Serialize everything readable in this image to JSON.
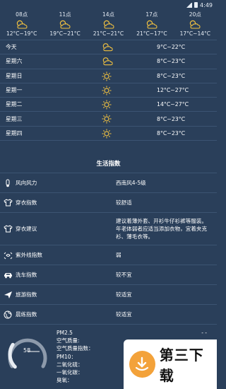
{
  "status": {
    "time": "4:49"
  },
  "hourly": [
    {
      "time": "08点",
      "icon": "partly-cloudy-icon",
      "range": "12°C~19°C"
    },
    {
      "time": "11点",
      "icon": "partly-cloudy-icon",
      "range": "19°C~21°C"
    },
    {
      "time": "14点",
      "icon": "partly-cloudy-icon",
      "range": "21°C~21°C"
    },
    {
      "time": "17点",
      "icon": "partly-cloudy-icon",
      "range": "21°C~17°C"
    },
    {
      "time": "20点",
      "icon": "partly-cloudy-icon",
      "range": "17°C~14°C"
    }
  ],
  "daily": [
    {
      "day": "今天",
      "icon": "partly-cloudy-icon",
      "temp": "9°C~22°C"
    },
    {
      "day": "星期六",
      "icon": "partly-cloudy-icon",
      "temp": "8°C~23°C"
    },
    {
      "day": "星期日",
      "icon": "sun-icon",
      "temp": "8°C~23°C"
    },
    {
      "day": "星期一",
      "icon": "sun-icon",
      "temp": "12°C~27°C"
    },
    {
      "day": "星期二",
      "icon": "sun-icon",
      "temp": "14°C~27°C"
    },
    {
      "day": "星期三",
      "icon": "sun-icon",
      "temp": "8°C~23°C"
    },
    {
      "day": "星期四",
      "icon": "sun-icon",
      "temp": "8°C~23°C"
    }
  ],
  "life": {
    "title": "生活指数",
    "items": [
      {
        "icon": "wind-icon",
        "label": "风向风力",
        "value": "西南风4-5级"
      },
      {
        "icon": "shirt-icon",
        "label": "穿衣指数",
        "value": "较舒适"
      },
      {
        "icon": "shirt-icon",
        "label": "穿衣建议",
        "value": "建议着薄外套、开衫牛仔衫裤等服装。年老体弱者应适当添加衣物，宜着夹克衫、薄毛衣等。"
      },
      {
        "icon": "uv-icon",
        "label": "紫外线指数",
        "value": "弱"
      },
      {
        "icon": "car-icon",
        "label": "洗车指数",
        "value": "较不宜"
      },
      {
        "icon": "plane-icon",
        "label": "旅游指数",
        "value": "较适宜"
      },
      {
        "icon": "globe-icon",
        "label": "晨练指数",
        "value": "较适宜"
      }
    ]
  },
  "aqi": {
    "value": "58",
    "level": 0.29,
    "labels": [
      "PM2.5",
      "空气质量:",
      "空气质量指数：",
      "PM10：",
      "二氧化硫：",
      "一氧化碳：",
      "臭氧："
    ],
    "values": [
      "- -",
      "- -",
      "58",
      "",
      "",
      "",
      ""
    ]
  },
  "watermark": {
    "text": "第三下载"
  }
}
